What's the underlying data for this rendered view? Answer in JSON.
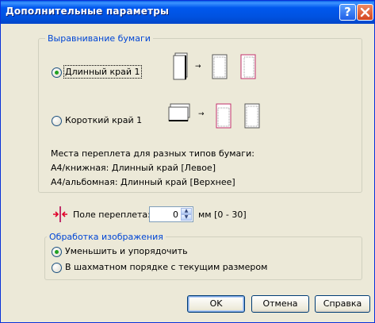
{
  "window": {
    "title": "Дополнительные параметры",
    "help_glyph": "?"
  },
  "paper_alignment": {
    "group_label": "Выравнивание бумаги",
    "long_edge_label": "Длинный край 1",
    "short_edge_label": "Короткий край 1",
    "selected": "long_edge",
    "arrow": "→",
    "binding_title": "Места переплета для разных типов бумаги:",
    "binding_portrait": "A4/книжная: Длинный край [Левое]",
    "binding_landscape": "A4/альбомная: Длинный край [Верхнее]"
  },
  "binding_margin": {
    "label": "Поле переплета:",
    "value": "0",
    "unit_range": "мм [0 - 30]"
  },
  "image_processing": {
    "group_label": "Обработка изображения",
    "option_reduce": "Уменьшить и упорядочить",
    "option_checkerboard": "В шахматном порядке с текущим размером",
    "selected": "reduce"
  },
  "buttons": {
    "ok": "OK",
    "cancel": "Отмена",
    "help": "Справка"
  },
  "colors": {
    "titlebar": "#0054e3",
    "accent_text": "#0046d5",
    "radio_dot": "#21a121",
    "page_border_pink": "#c0306a"
  },
  "icons": [
    "help-icon",
    "close-icon",
    "binding-margin-icon",
    "spin-up-icon",
    "spin-down-icon"
  ]
}
